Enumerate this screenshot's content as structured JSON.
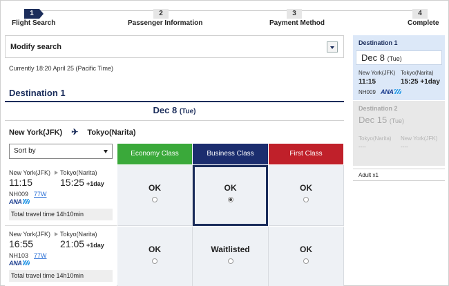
{
  "progress": {
    "steps": [
      {
        "num": "1",
        "label": "Flight Search",
        "active": true
      },
      {
        "num": "2",
        "label": "Passenger Information",
        "active": false
      },
      {
        "num": "3",
        "label": "Payment Method",
        "active": false
      },
      {
        "num": "4",
        "label": "Complete",
        "active": false
      }
    ]
  },
  "modify": {
    "label": "Modify search"
  },
  "current_time": "Currently 18:20 April 25 (Pacific Time)",
  "destination": {
    "title": "Destination 1",
    "date": "Dec 8",
    "dow": "(Tue)",
    "from": "New York(JFK)",
    "to": "Tokyo(Narita)",
    "plane_icon": "✈"
  },
  "sort": {
    "label": "Sort by"
  },
  "classes": {
    "economy": "Economy Class",
    "business": "Business Class",
    "first": "First Class",
    "colors": {
      "economy": "#3aa93a",
      "business": "#1b2d6e",
      "first": "#c0202a"
    }
  },
  "flights": [
    {
      "from": "New York(JFK)",
      "to": "Tokyo(Narita)",
      "dep": "11:15",
      "arr": "15:25",
      "plus": "+1day",
      "flight_no": "NH009",
      "equipment": "77W",
      "airline": "ANA",
      "travel": "Total travel time 14h10min",
      "economy": "OK",
      "business": "OK",
      "first": "OK",
      "selected": "business"
    },
    {
      "from": "New York(JFK)",
      "to": "Tokyo(Narita)",
      "dep": "16:55",
      "arr": "21:05",
      "plus": "+1day",
      "flight_no": "NH103",
      "equipment": "77W",
      "airline": "ANA",
      "travel": "Total travel time 14h10min",
      "economy": "OK",
      "business": "Waitlisted",
      "first": "OK",
      "selected": null
    }
  ],
  "sidebar": {
    "dest1": {
      "title": "Destination 1",
      "date": "Dec  8",
      "dow": "(Tue)",
      "from": "New York(JFK)",
      "to": "Tokyo(Narita)",
      "dep": "11:15",
      "arr": "15:25 +1day",
      "flight_no": "NH009",
      "airline": "ANA"
    },
    "dest2": {
      "title": "Destination 2",
      "date": "Dec 15",
      "dow": "(Tue)",
      "from": "Tokyo(Narita)",
      "to": "New York(JFK)",
      "dash1": "----",
      "dash2": "----"
    },
    "passengers": "Adult x1"
  }
}
